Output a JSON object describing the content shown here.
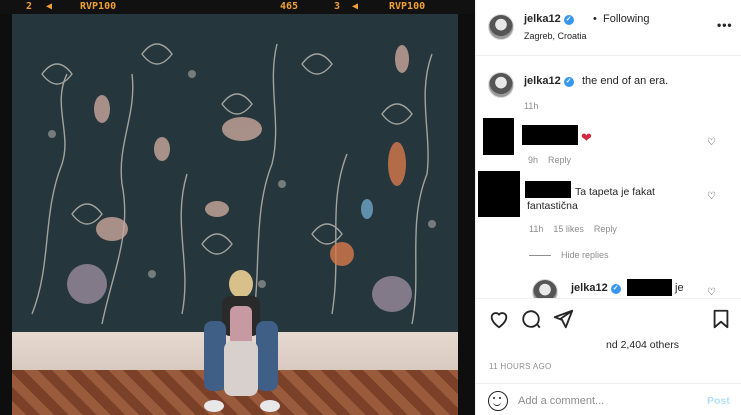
{
  "photo": {
    "film_strip": {
      "frame_left": "2",
      "code_left": "RVP100",
      "frame_number": "465",
      "frame_right": "3",
      "code_right": "RVP100",
      "arrow_icon": "triangle-left-icon"
    },
    "description_icon": "photo"
  },
  "header": {
    "username": "jelka12",
    "verified_icon": "verified-badge-icon",
    "dot": "•",
    "follow_status": "Following",
    "location": "Zagreb, Croatia",
    "more_icon": "more-options-icon"
  },
  "caption": {
    "username": "jelka12",
    "text": "the end of an era.",
    "time": "11h"
  },
  "comments": [
    {
      "time": "9h",
      "reply_label": "Reply",
      "reaction_icon": "red-heart-icon"
    },
    {
      "text_line1": "Ta tapeta je fakat",
      "text_line2": "fantastična",
      "time": "11h",
      "likes": "15 likes",
      "reply_label": "Reply"
    }
  ],
  "hide_replies_label": "Hide replies",
  "reply": {
    "username": "jelka12",
    "prefix": "@",
    "tail": "je"
  },
  "actions": {
    "like_icon": "heart-outline-icon",
    "comment_icon": "comment-bubble-icon",
    "share_icon": "paper-plane-icon",
    "save_icon": "bookmark-icon",
    "likes_text": "nd 2,404 others",
    "time_ago": "11 HOURS AGO"
  },
  "comment_bar": {
    "emoji_icon": "emoji-icon",
    "placeholder": "Add a comment...",
    "post_label": "Post"
  },
  "colors": {
    "verified": "#3897f0",
    "heart": "#d4263d",
    "post_disabled": "#b2dffc",
    "secondary_text": "#8e8e8e",
    "film_text": "#f0a030"
  }
}
